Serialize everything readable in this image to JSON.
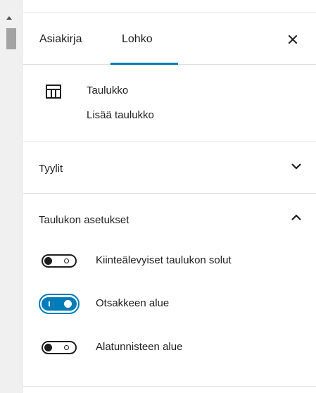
{
  "tabs": {
    "document_label": "Asiakirja",
    "block_label": "Lohko",
    "close_icon": "close-icon"
  },
  "block": {
    "icon": "table-icon",
    "title": "Taulukko",
    "description": "Lisää taulukko"
  },
  "sections": {
    "styles": {
      "title": "Tyylit",
      "expanded": false
    },
    "table_settings": {
      "title": "Taulukon asetukset",
      "expanded": true,
      "toggles": [
        {
          "label": "Kiinteälevyiset taulukon solut",
          "checked": false
        },
        {
          "label": "Otsakkeen alue",
          "checked": true
        },
        {
          "label": "Alatunnisteen alue",
          "checked": false
        }
      ]
    }
  },
  "colors": {
    "accent": "#007cba",
    "text": "#1e1e1e",
    "divider": "#e0e0e0"
  }
}
